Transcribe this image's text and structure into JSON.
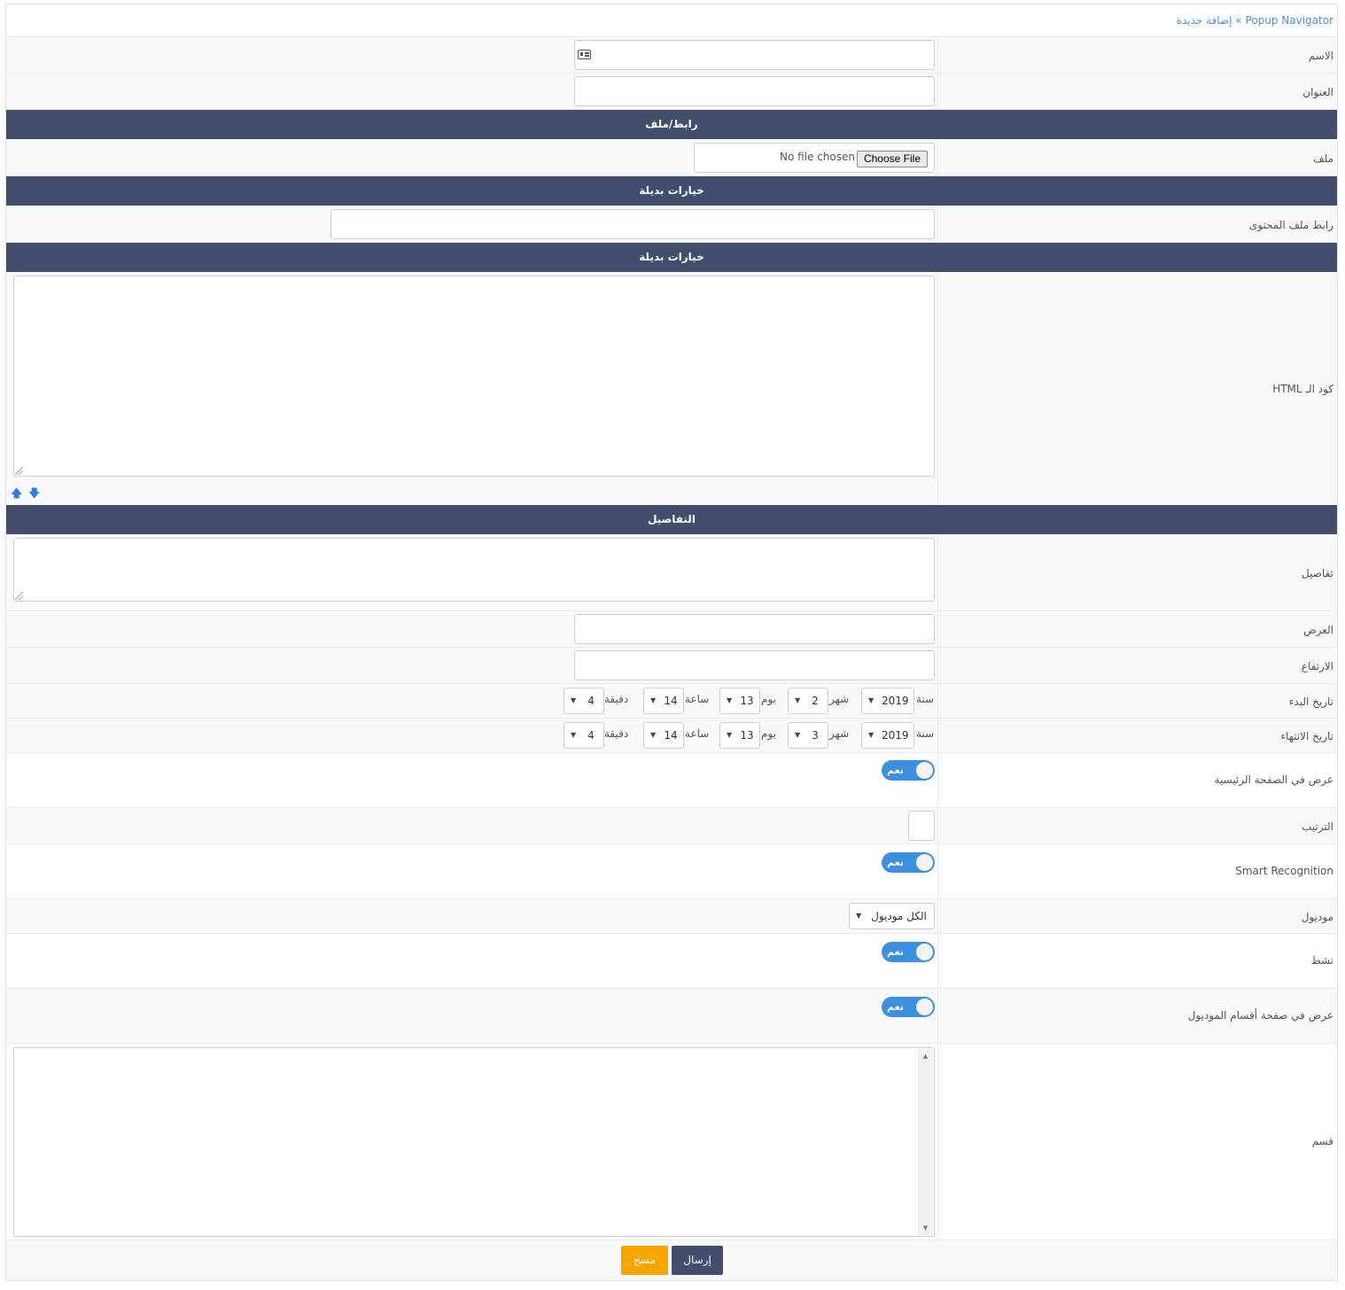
{
  "breadcrumb": {
    "module": "Popup Navigator",
    "separator": "»",
    "page": "إضافة جديدة"
  },
  "form": {
    "name": {
      "label": "الاسم",
      "value": ""
    },
    "title": {
      "label": "العنوان",
      "value": ""
    },
    "section_link_file": "رابط/ملف",
    "file": {
      "label": "ملف",
      "button": "Choose File",
      "status": "No file chosen"
    },
    "section_alternatives_1": "خيارات بديلة",
    "content_url": {
      "label": "رابط ملف المحتوى",
      "value": ""
    },
    "section_alternatives_2": "خيارات بديلة",
    "html_code": {
      "label": "كود الـ HTML",
      "value": "",
      "up_icon": "arrow-up-icon",
      "down_icon": "arrow-down-icon"
    },
    "section_details": "التفاصيل",
    "details": {
      "label": "تفاصيل",
      "value": ""
    },
    "width": {
      "label": "العرض",
      "value": ""
    },
    "height": {
      "label": "الارتفاع",
      "value": ""
    },
    "start_date": {
      "label": "تاريخ البدء",
      "year_label": "سنة",
      "year": "2019",
      "month_label": "شهر",
      "month": "2",
      "day_label": "يوم",
      "day": "13",
      "hour_label": "ساعة",
      "hour": "14",
      "minute_label": "دقيقة",
      "minute": "4"
    },
    "end_date": {
      "label": "تاريخ الانتهاء",
      "year_label": "سنة",
      "year": "2019",
      "month_label": "شهر",
      "month": "3",
      "day_label": "يوم",
      "day": "13",
      "hour_label": "ساعة",
      "hour": "14",
      "minute_label": "دقيقة",
      "minute": "4"
    },
    "show_on_home": {
      "label": "عرض في الصفحة الرئيسية",
      "toggle": "نعم"
    },
    "order": {
      "label": "الترتيب",
      "value": ""
    },
    "smart_recognition": {
      "label": "Smart Recognition",
      "toggle": "نعم"
    },
    "module": {
      "label": "موديول",
      "selected": "الكل موديول"
    },
    "active": {
      "label": "نشط",
      "toggle": "نعم"
    },
    "show_on_module_categories": {
      "label": "عرض في صفحة أقسام الموديول",
      "toggle": "نعم"
    },
    "category": {
      "label": "قسم"
    }
  },
  "actions": {
    "submit": "إرسال",
    "reset": "مسح"
  },
  "colors": {
    "section_bg": "#424e6b",
    "toggle_on": "#3d8fe0",
    "submit_bg": "#424e6b",
    "reset_bg": "#f7a600",
    "link": "#4a90e2"
  }
}
